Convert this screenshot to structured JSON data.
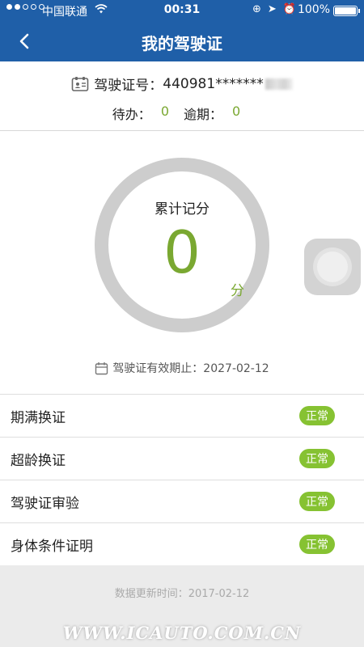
{
  "status_bar": {
    "carrier": "中国联通",
    "time": "00:31",
    "battery": "100%"
  },
  "nav": {
    "title": "我的驾驶证"
  },
  "license": {
    "label": "驾驶证号：",
    "number": "440981*******",
    "pending_label": "待办：",
    "pending_count": "0",
    "overdue_label": "逾期：",
    "overdue_count": "0"
  },
  "score": {
    "label": "累计记分",
    "value": "0",
    "unit": "分"
  },
  "validity": {
    "text": "驾驶证有效期止：2027-02-12"
  },
  "status_items": [
    {
      "label": "期满换证",
      "status": "正常"
    },
    {
      "label": "超龄换证",
      "status": "正常"
    },
    {
      "label": "驾驶证审验",
      "status": "正常"
    },
    {
      "label": "身体条件证明",
      "status": "正常"
    }
  ],
  "footer": {
    "update_text": "数据更新时间：2017-02-12",
    "watermark": "WWW.ICAUTO.COM.CN"
  },
  "colors": {
    "nav_blue": "#1f5fa8",
    "accent_green": "#7aa831",
    "badge_green": "#86c232",
    "ring_gray": "#cdcdcd"
  }
}
